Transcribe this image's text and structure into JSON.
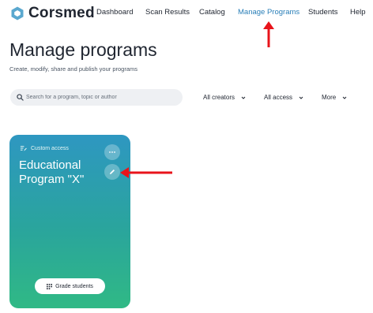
{
  "brand": {
    "name": "Corsmed",
    "accent": "#2a7fb8",
    "logo_color": "#5aa8cf"
  },
  "nav": {
    "items": [
      {
        "label": "Dashboard"
      },
      {
        "label": "Scan Results"
      },
      {
        "label": "Catalog"
      },
      {
        "label": "Manage Programs",
        "active": true
      },
      {
        "label": "Students"
      },
      {
        "label": "Help"
      }
    ]
  },
  "page": {
    "title": "Manage programs",
    "subtitle": "Create, modify, share and publish your programs"
  },
  "search": {
    "placeholder": "Search for a program, topic or author",
    "icon": "search-icon"
  },
  "filters": [
    {
      "label": "All creators",
      "icon": "chevron-down-icon"
    },
    {
      "label": "All access",
      "icon": "chevron-down-icon"
    },
    {
      "label": "More",
      "icon": "chevron-down-icon"
    }
  ],
  "program_card": {
    "access_label": "Custom access",
    "title": "Educational Program \"X\"",
    "more_icon": "more-horizontal-icon",
    "edit_icon": "pencil-icon",
    "grade_button_label": "Grade students",
    "grade_icon": "grid-icon",
    "gradient": [
      "#2e97c1",
      "#2aa59c",
      "#30b985"
    ]
  },
  "annotations": {
    "arrow_color": "#e8141b"
  }
}
